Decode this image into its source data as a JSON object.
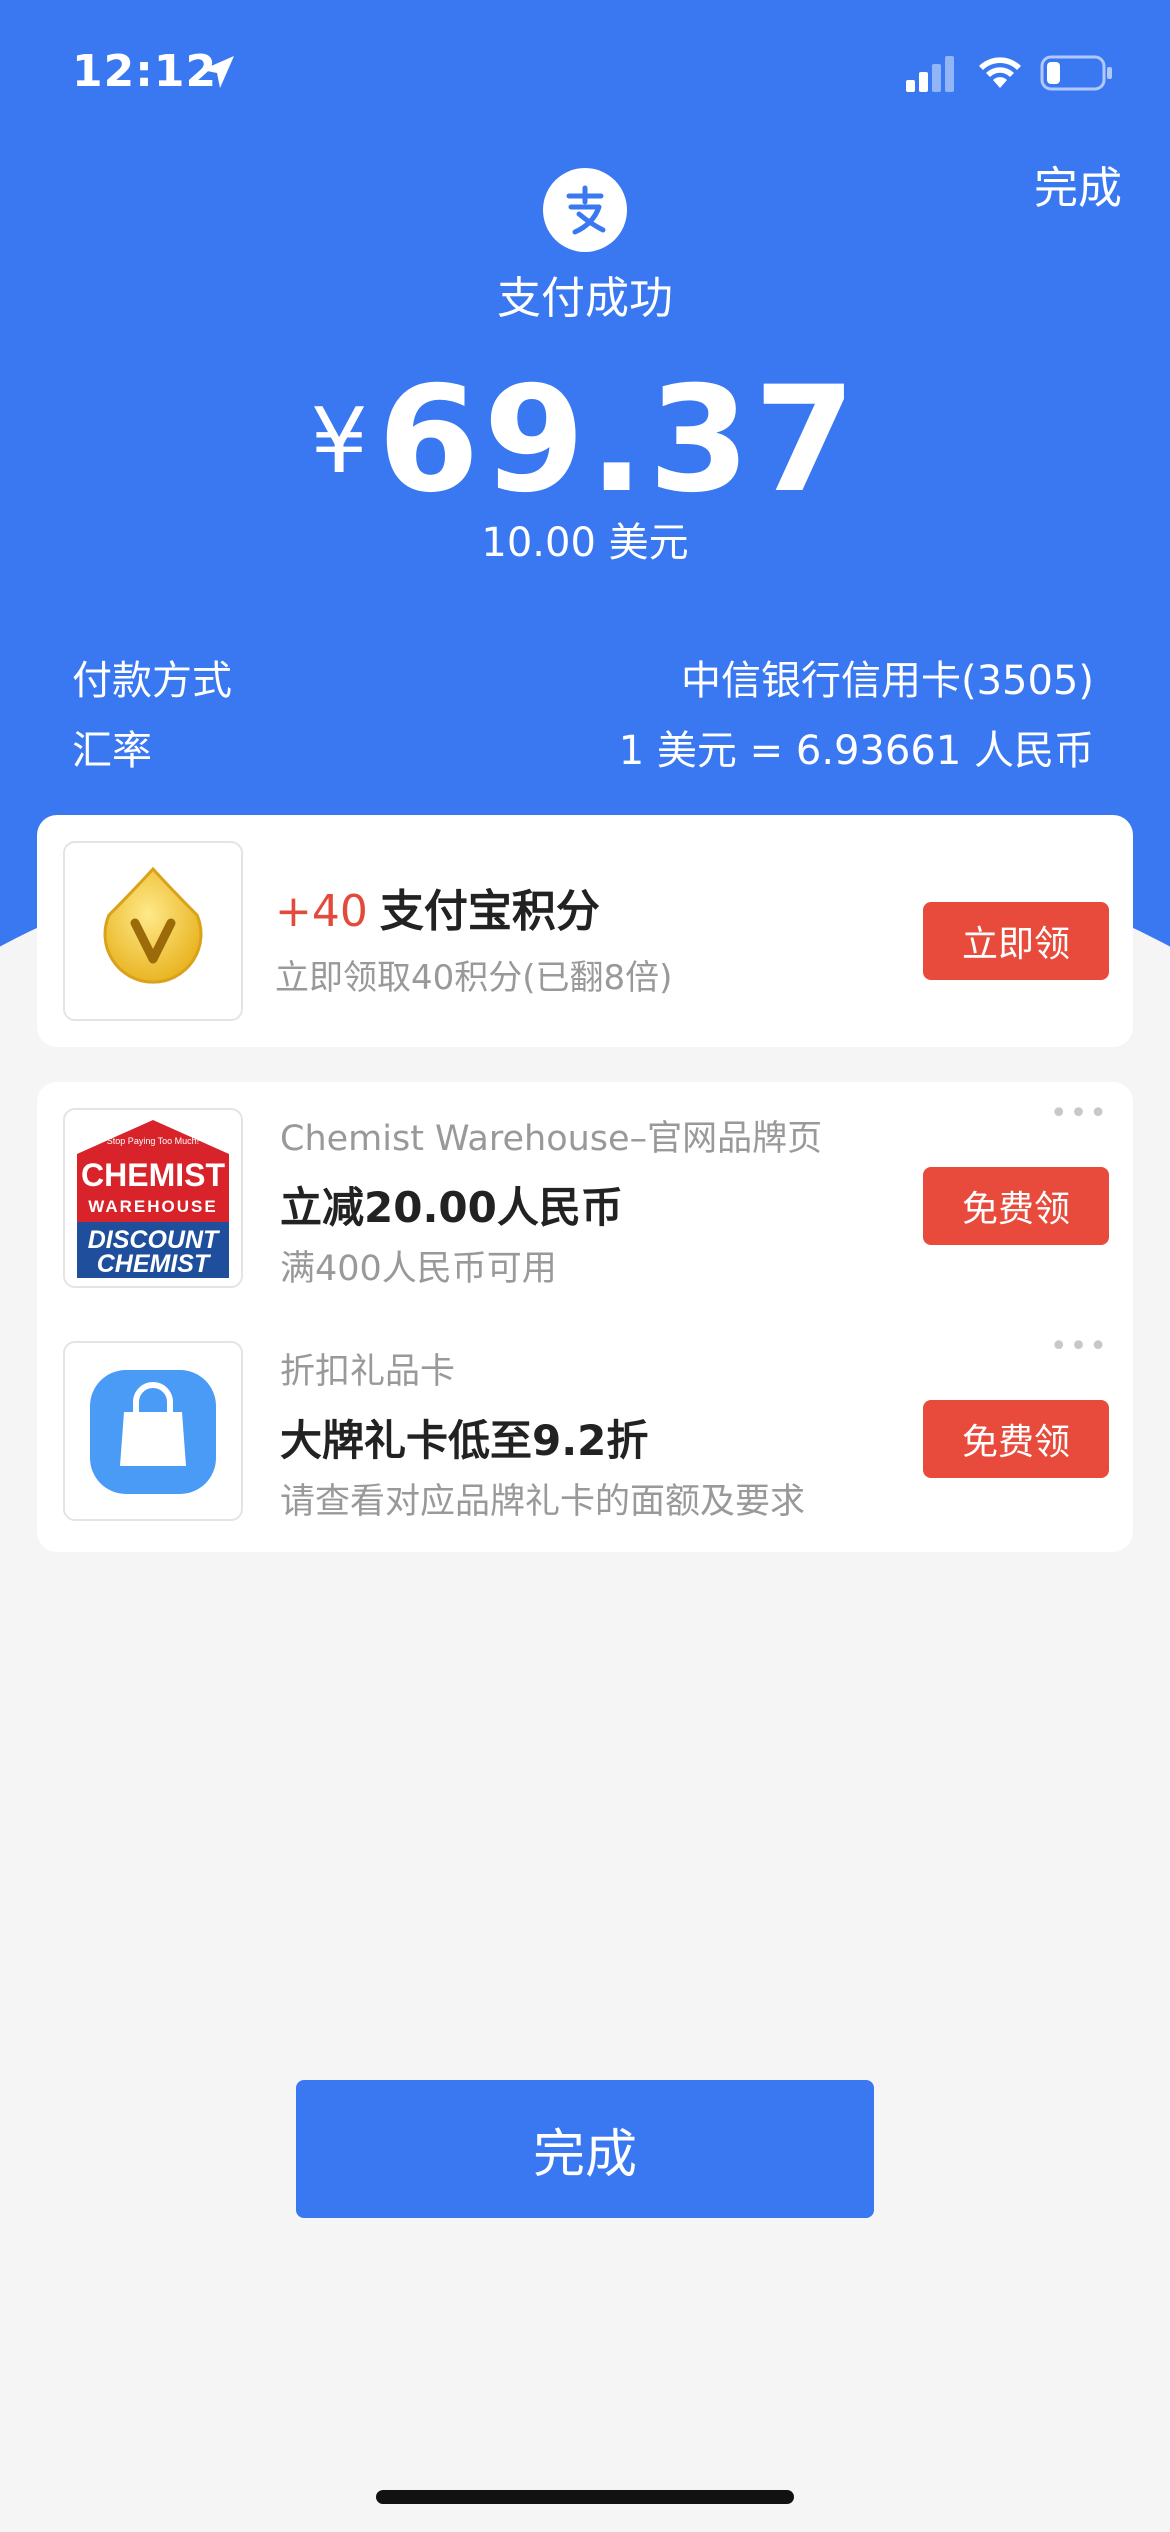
{
  "status_bar": {
    "time": "12:12"
  },
  "header": {
    "done_label": "完成",
    "title": "支付成功",
    "currency_symbol": "¥",
    "amount": "69.37",
    "original_amount": "10.00 美元"
  },
  "details": [
    {
      "label": "付款方式",
      "value": "中信银行信用卡(3505)"
    },
    {
      "label": "汇率",
      "value": "1 美元 = 6.93661 人民币"
    }
  ],
  "points_card": {
    "points_plus": "+40",
    "title": "支付宝积分",
    "subtitle": "立即领取40积分(已翻8倍)",
    "button": "立即领"
  },
  "offers": [
    {
      "source": "Chemist Warehouse–官网品牌页",
      "title": "立减20.00人民币",
      "subtitle": "满400人民币可用",
      "button": "免费领",
      "more": "•••"
    },
    {
      "source": "折扣礼品卡",
      "title": "大牌礼卡低至9.2折",
      "subtitle": "请查看对应品牌礼卡的面额及要求",
      "button": "免费领",
      "more": "•••"
    }
  ],
  "logo_text": {
    "line1": "CHEMIST",
    "line2": "WAREHOUSE",
    "line3": "DISCOUNT",
    "line4": "CHEMIST",
    "tagline": "Stop Paying Too Much!"
  },
  "footer": {
    "done_label": "完成"
  },
  "colors": {
    "brand_blue": "#3a78f2",
    "accent_red": "#e84b3c",
    "background": "#f5f5f5"
  }
}
